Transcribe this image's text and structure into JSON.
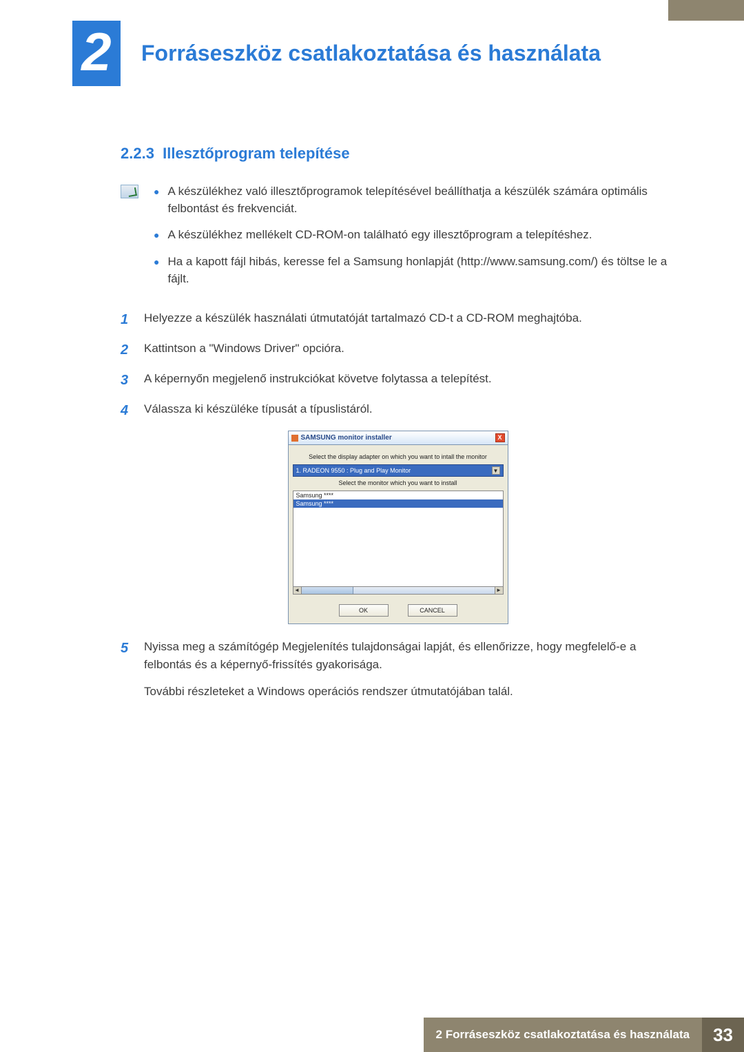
{
  "chapter": {
    "number": "2",
    "title": "Forráseszköz csatlakoztatása és használata"
  },
  "section": {
    "number": "2.2.3",
    "title": "Illesztőprogram telepítése"
  },
  "notes": [
    "A készülékhez való illesztőprogramok telepítésével beállíthatja a készülék számára optimális felbontást és frekvenciát.",
    "A készülékhez mellékelt CD-ROM-on található egy illesztőprogram a telepítéshez.",
    "Ha a kapott fájl hibás, keresse fel a Samsung honlapját (http://www.samsung.com/) és töltse le a fájlt."
  ],
  "steps": {
    "s1": {
      "num": "1",
      "text": "Helyezze a készülék használati útmutatóját tartalmazó CD-t a CD-ROM meghajtóba."
    },
    "s2": {
      "num": "2",
      "text": "Kattintson a \"Windows Driver\" opcióra."
    },
    "s3": {
      "num": "3",
      "text": "A képernyőn megjelenő instrukciókat követve folytassa a telepítést."
    },
    "s4": {
      "num": "4",
      "text": "Válassza ki készüléke típusát a típuslistáról."
    },
    "s5": {
      "num": "5",
      "text": "Nyissa meg a számítógép Megjelenítés tulajdonságai lapját, és ellenőrizze, hogy megfelelő-e a felbontás és a képernyő-frissítés gyakorisága.",
      "extra": "További részleteket a Windows operációs rendszer útmutatójában talál."
    }
  },
  "mock": {
    "title": "SAMSUNG monitor installer",
    "label1": "Select the display adapter on which you want to intall the monitor",
    "dropdown": "1. RADEON 9550 : Plug and Play Monitor",
    "label2": "Select the monitor which you want to install",
    "list0": "Samsung ****",
    "list1": "Samsung ****",
    "ok": "OK",
    "cancel": "CANCEL"
  },
  "footer": {
    "text": "2 Forráseszköz csatlakoztatása és használata",
    "page": "33"
  }
}
